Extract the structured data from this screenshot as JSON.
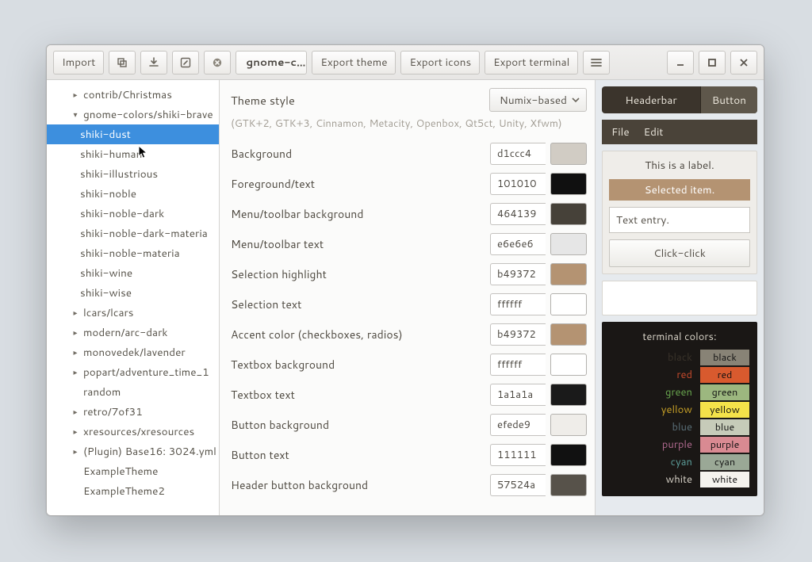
{
  "toolbar": {
    "import_label": "Import",
    "tab_title": "gnome-c…",
    "export_theme_label": "Export theme",
    "export_icons_label": "Export icons",
    "export_terminal_label": "Export terminal"
  },
  "sidebar": {
    "items": [
      {
        "label": "contrib/Christmas",
        "expandable": true,
        "expanded": false,
        "level": 1
      },
      {
        "label": "gnome-colors/shiki-brave",
        "expandable": true,
        "expanded": true,
        "level": 1
      },
      {
        "label": "shiki-dust",
        "expandable": false,
        "level": 2,
        "selected": true
      },
      {
        "label": "shiki-human",
        "expandable": false,
        "level": 2
      },
      {
        "label": "shiki-illustrious",
        "expandable": false,
        "level": 2
      },
      {
        "label": "shiki-noble",
        "expandable": false,
        "level": 2
      },
      {
        "label": "shiki-noble-dark",
        "expandable": false,
        "level": 2
      },
      {
        "label": "shiki-noble-dark-materia",
        "expandable": false,
        "level": 2
      },
      {
        "label": "shiki-noble-materia",
        "expandable": false,
        "level": 2
      },
      {
        "label": "shiki-wine",
        "expandable": false,
        "level": 2
      },
      {
        "label": "shiki-wise",
        "expandable": false,
        "level": 2
      },
      {
        "label": "lcars/lcars",
        "expandable": true,
        "expanded": false,
        "level": 1
      },
      {
        "label": "modern/arc-dark",
        "expandable": true,
        "expanded": false,
        "level": 1
      },
      {
        "label": "monovedek/lavender",
        "expandable": true,
        "expanded": false,
        "level": 1
      },
      {
        "label": "popart/adventure_time_1",
        "expandable": true,
        "expanded": false,
        "level": 1
      },
      {
        "label": "random",
        "expandable": false,
        "level": 1
      },
      {
        "label": "retro/7of31",
        "expandable": true,
        "expanded": false,
        "level": 1
      },
      {
        "label": "xresources/xresources",
        "expandable": true,
        "expanded": false,
        "level": 1
      },
      {
        "label": "(Plugin) Base16: 3024.yml",
        "expandable": true,
        "expanded": false,
        "level": 1
      },
      {
        "label": "ExampleTheme",
        "expandable": false,
        "level": 1
      },
      {
        "label": "ExampleTheme2",
        "expandable": false,
        "level": 1
      }
    ]
  },
  "theme": {
    "style_title": "Theme style",
    "style_selected": "Numix-based",
    "style_sub": "(GTK+2, GTK+3, Cinnamon, Metacity, Openbox, Qt5ct, Unity, Xfwm)",
    "props": [
      {
        "label": "Background",
        "hex": "d1ccc4",
        "swatch": "#d1ccc4"
      },
      {
        "label": "Foreground/text",
        "hex": "101010",
        "swatch": "#101010"
      },
      {
        "label": "Menu/toolbar background",
        "hex": "464139",
        "swatch": "#464139"
      },
      {
        "label": "Menu/toolbar text",
        "hex": "e6e6e6",
        "swatch": "#e6e6e6"
      },
      {
        "label": "Selection highlight",
        "hex": "b49372",
        "swatch": "#b49372"
      },
      {
        "label": "Selection text",
        "hex": "ffffff",
        "swatch": "#ffffff"
      },
      {
        "label": "Accent color (checkboxes, radios)",
        "hex": "b49372",
        "swatch": "#b49372"
      },
      {
        "label": "Textbox background",
        "hex": "ffffff",
        "swatch": "#ffffff"
      },
      {
        "label": "Textbox text",
        "hex": "1a1a1a",
        "swatch": "#1a1a1a"
      },
      {
        "label": "Button background",
        "hex": "efede9",
        "swatch": "#efede9"
      },
      {
        "label": "Button text",
        "hex": "111111",
        "swatch": "#111111"
      },
      {
        "label": "Header button background",
        "hex": "57524a",
        "swatch": "#57524a"
      }
    ]
  },
  "preview": {
    "headerbar_title": "Headerbar",
    "headerbar_button": "Button",
    "menu_file": "File",
    "menu_edit": "Edit",
    "label_text": "This is a label.",
    "selected_text": "Selected item.",
    "entry_text": "Text entry.",
    "button_text": "Click-click",
    "terminal_title": "terminal colors:",
    "term_colors": [
      {
        "name": "black",
        "name_color": "#3a332a",
        "chip_bg": "#888376",
        "chip_text": "black"
      },
      {
        "name": "red",
        "name_color": "#c84a2c",
        "chip_bg": "#d85a2e",
        "chip_text": "red"
      },
      {
        "name": "green",
        "name_color": "#6aa84f",
        "chip_bg": "#9cb77f",
        "chip_text": "green"
      },
      {
        "name": "yellow",
        "name_color": "#c9a227",
        "chip_bg": "#f4e24a",
        "chip_text": "yellow"
      },
      {
        "name": "blue",
        "name_color": "#5a6f78",
        "chip_bg": "#c6cbb9",
        "chip_text": "blue"
      },
      {
        "name": "purple",
        "name_color": "#b06a8f",
        "chip_bg": "#d98a92",
        "chip_text": "purple"
      },
      {
        "name": "cyan",
        "name_color": "#5c9e9a",
        "chip_bg": "#9aa896",
        "chip_text": "cyan"
      },
      {
        "name": "white",
        "name_color": "#d6d1c6",
        "chip_bg": "#f5f3ee",
        "chip_text": "white"
      }
    ]
  }
}
